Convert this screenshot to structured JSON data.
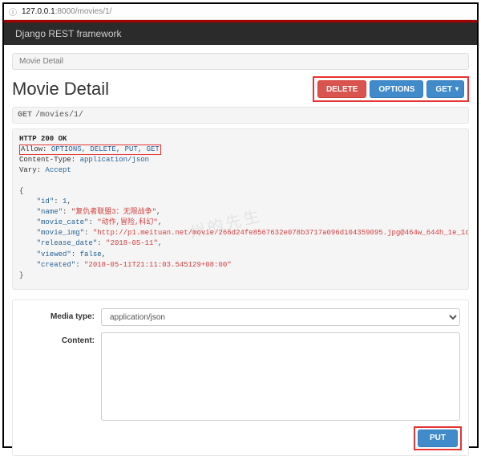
{
  "url": {
    "secure_icon": "ⓘ",
    "host": "127.0.0.1",
    "port": ":8000",
    "path": "/movies/1/"
  },
  "navbar": {
    "brand": "Django REST framework"
  },
  "breadcrumb": {
    "label": "Movie Detail"
  },
  "page_title": "Movie Detail",
  "action_buttons": {
    "delete_label": "DELETE",
    "options_label": "OPTIONS",
    "get_label": "GET",
    "caret_glyph": "▾"
  },
  "request_line": {
    "verb": "GET",
    "path": "/movies/1/"
  },
  "response": {
    "status_line": "HTTP 200 OK",
    "headers": {
      "allow_key": "Allow:",
      "allow_val": "OPTIONS, DELETE, PUT, GET",
      "ctype_key": "Content-Type:",
      "ctype_val": "application/json",
      "vary_key": "Vary:",
      "vary_val": "Accept"
    },
    "body": {
      "id": 1,
      "name": "\"复仇者联盟3：无限战争\"",
      "movie_cate": "\"动作,冒险,科幻\"",
      "movie_img": "\"http://p1.meituan.net/movie/266d24fe8567632e078b3717a096d104359095.jpg@464w_644h_1e_1c\"",
      "release_date": "\"2018-05-11\"",
      "viewed": "false",
      "created": "\"2018-05-11T21:11:03.545129+08:00\""
    }
  },
  "form": {
    "media_type_label": "Media type:",
    "media_type_value": "application/json",
    "content_label": "Content:",
    "content_value": "",
    "put_label": "PUT"
  },
  "watermark": "州的先生"
}
